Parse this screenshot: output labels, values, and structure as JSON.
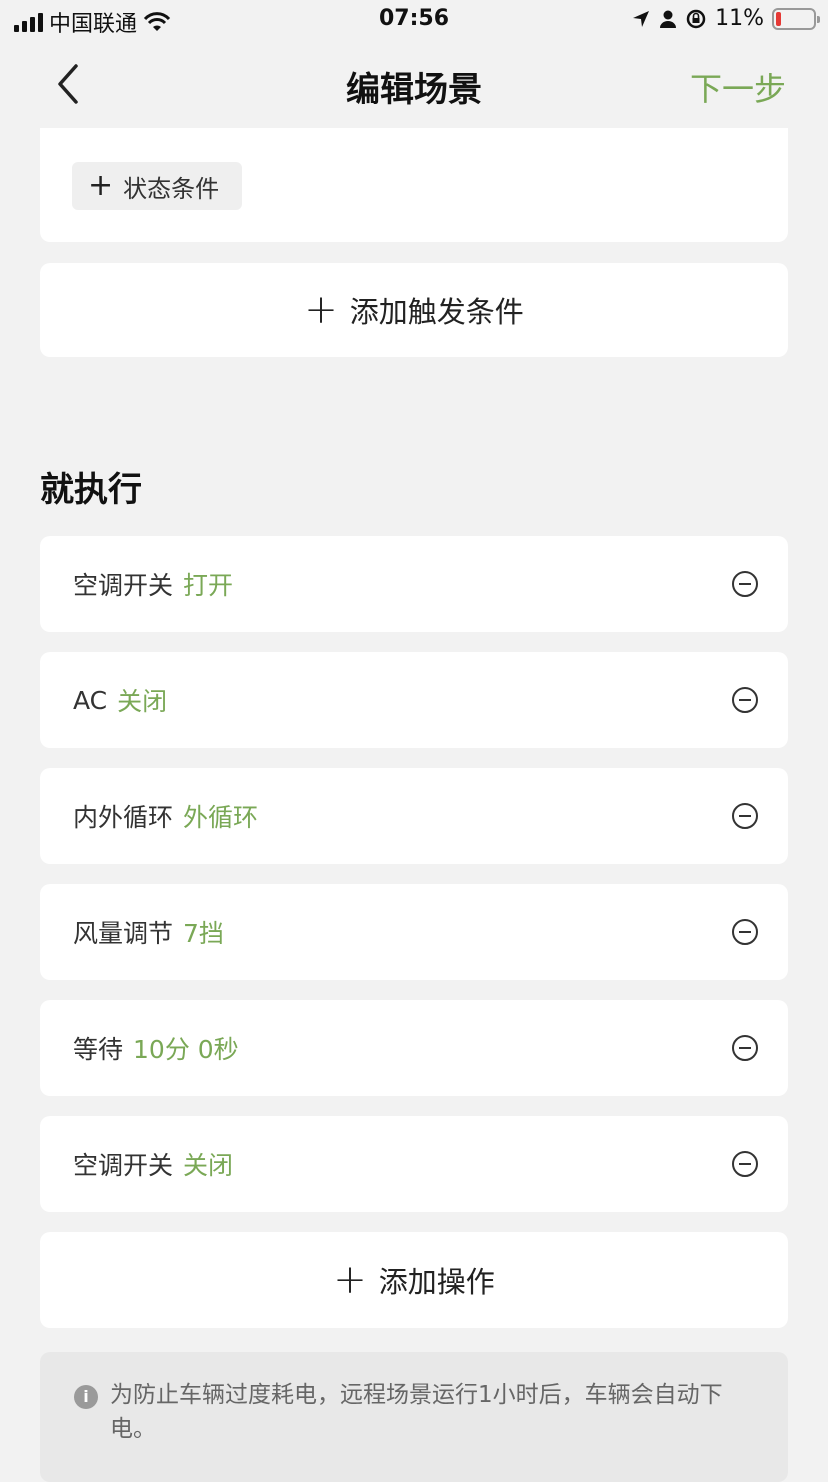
{
  "status_bar": {
    "carrier": "中国联通",
    "time": "07:56",
    "battery": "11%"
  },
  "nav": {
    "title": "编辑场景",
    "next_label": "下一步"
  },
  "trigger_section": {
    "state_condition_label": "状态条件",
    "add_trigger_label": "添加触发条件"
  },
  "execute_section": {
    "title": "就执行",
    "actions": [
      {
        "name": "空调开关",
        "value": "打开"
      },
      {
        "name": "AC",
        "value": "关闭"
      },
      {
        "name": "内外循环",
        "value": "外循环"
      },
      {
        "name": "风量调节",
        "value": "7挡"
      },
      {
        "name": "等待",
        "value": "10分 0秒"
      },
      {
        "name": "空调开关",
        "value": "关闭"
      }
    ],
    "add_action_label": "添加操作"
  },
  "notice": {
    "text": "为防止车辆过度耗电，远程场景运行1小时后，车辆会自动下电。"
  },
  "colors": {
    "accent": "#7aa856",
    "background": "#f2f2f2",
    "card": "#ffffff",
    "battery_low": "#e53935"
  }
}
